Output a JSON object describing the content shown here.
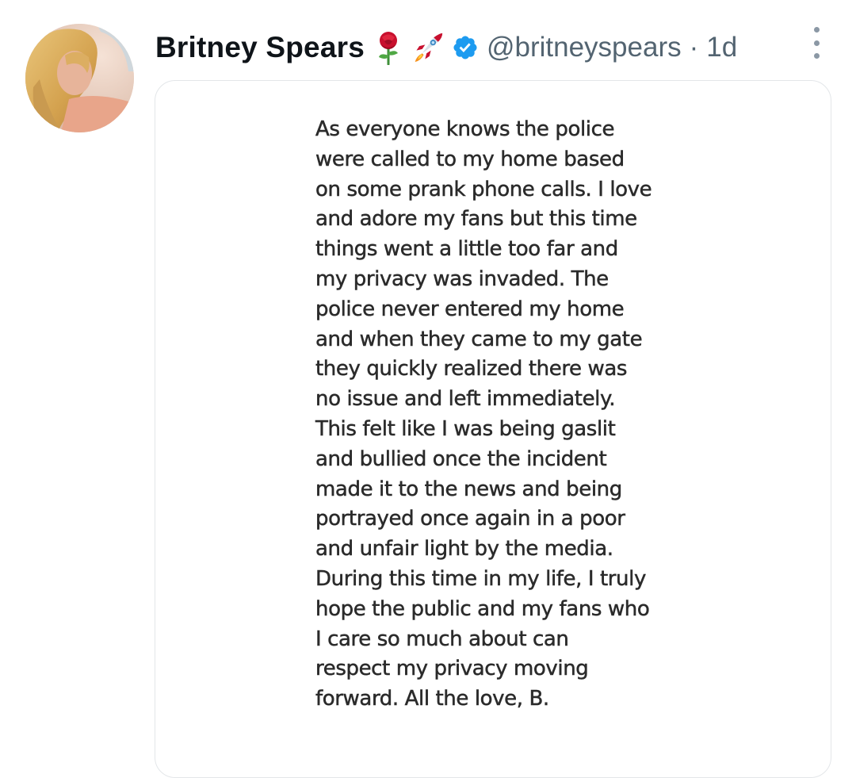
{
  "tweet": {
    "display_name": "Britney Spears",
    "emojis": [
      "rose-icon",
      "rocket-icon"
    ],
    "verified_icon": "verified-badge-icon",
    "handle": "@britneyspears",
    "separator": "·",
    "time": "1d",
    "more_icon": "more-options-icon",
    "media": {
      "lines": [
        "As everyone knows the police",
        "were called to my home based",
        "on some prank phone calls. I love",
        "and adore my fans but this time",
        "things went a little too far and",
        "my privacy was invaded. The",
        "police never entered my home",
        "and when they came to my gate",
        "they quickly realized there was",
        "no issue and left immediately.",
        "This felt like I was being gaslit",
        "and bullied once the incident",
        "made it to the news and being",
        "portrayed once again in a poor",
        "and unfair light by the media.",
        "During this time in my life, I truly",
        "hope the public and my fans who",
        "I care so much about can",
        "respect my privacy moving",
        "forward. All the love, B."
      ]
    }
  },
  "colors": {
    "name": "#0f1419",
    "secondary": "#536471",
    "verified": "#1d9bf0",
    "card_border": "#e3e6e9",
    "note_text": "#2b2b2b"
  }
}
